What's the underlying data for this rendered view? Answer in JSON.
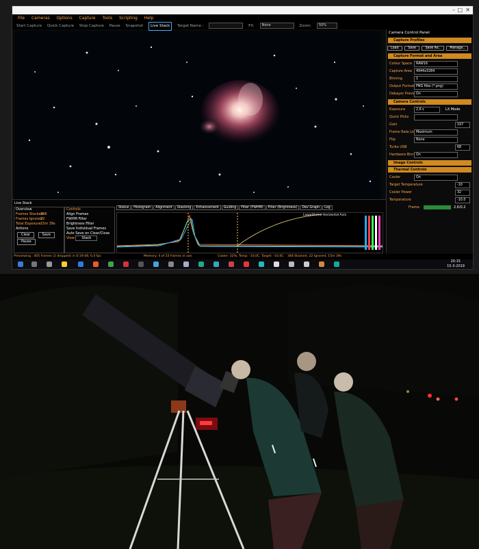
{
  "menu": [
    "File",
    "Cameras",
    "Options",
    "Capture",
    "Tools",
    "Scripting",
    "Help"
  ],
  "toolbar": {
    "items": [
      "Start Capture",
      "Quick Capture",
      "Stop Capture",
      "Pause",
      "Snapshot"
    ],
    "live_stack": "Live Stack",
    "target_label": "Target Name :",
    "fx_label": "FX:",
    "fx_value": "None",
    "zoom_label": "Zoom:",
    "zoom_value": "50%"
  },
  "panel": {
    "title": "Camera Control Panel",
    "capture_profiles": "Capture Profiles",
    "profile_buttons": [
      "Load",
      "Save",
      "Save As..",
      "Manage.."
    ],
    "capture_format": "Capture Format and Area",
    "colour_space_label": "Colour Space",
    "colour_space": "RAW16",
    "capture_area_label": "Capture Area",
    "capture_area": "4944x3284",
    "binning_label": "Binning",
    "binning": "1",
    "output_format_label": "Output Format",
    "output_format": "PNG files (*.png)",
    "debayer_label": "Debayer Preview",
    "debayer": "On",
    "camera_controls": "Camera Controls",
    "exposure_label": "Exposure",
    "exposure": "2,6 s",
    "lx_mode": "LX Mode",
    "quick_picks_label": "Quick Picks",
    "gain_label": "Gain",
    "gain": "197",
    "frame_rate_label": "Frame Rate Limit",
    "frame_rate": "Maximum",
    "flip_label": "Flip",
    "flip": "None",
    "turbo_usb_label": "Turbo USB",
    "turbo_usb": "68",
    "hw_binning_label": "Hardware Binning",
    "hw_binning": "On",
    "image_controls": "Image Controls",
    "thermal_controls": "Thermal Controls",
    "cooler_label": "Cooler",
    "cooler": "On",
    "target_temp_label": "Target Temperature",
    "target_temp": "-10",
    "cooler_power_label": "Cooler Power",
    "cooler_power": "32",
    "temperature_label": "Temperature",
    "temperature": "-10.0",
    "frame_label": "Frame:",
    "frame_value": "2,6/0,2"
  },
  "live_stack": {
    "title": "Live Stack",
    "overview_label": "Overview",
    "frames_stacked_label": "Frames Stacked:",
    "frames_stacked": "348",
    "frames_ignored_label": "Frames Ignored:",
    "frames_ignored": "22",
    "total_exposure_label": "Total Exposure:",
    "total_exposure": "15m 39s",
    "actions_label": "Actions",
    "clear": "Clear",
    "save": "Save",
    "pause": "Pause",
    "controls_label": "Controls",
    "controls": [
      "Align Frames",
      "FWHM Filter",
      "Brightness Filter",
      "Save Individual Frames",
      "Auto Save on Clear/Close"
    ],
    "view_label": "View",
    "view_value": "Stack",
    "tabs": [
      "Status",
      "Histogram",
      "Alignment",
      "Stacking",
      "Enhancement",
      "Guiding",
      "Filter (FWHM)",
      "Filter (Brightness)",
      "Dev Graph",
      "Log"
    ],
    "log_axis": "Logarithmic Horizontal Axis"
  },
  "status": {
    "preview": "Previewing : 405 frames (2 dropped) in 0:19:48, 0,4 fps",
    "memory": "Memory: 4 of 33 frames in use.",
    "cooler": "Cooler: 32%, Temp: -10,0C, Target: -10,0C",
    "stack": "348 Stacked, 22 Ignored, 15m 39s"
  },
  "taskbar": {
    "time": "20:15",
    "date": "15-3-2019"
  }
}
